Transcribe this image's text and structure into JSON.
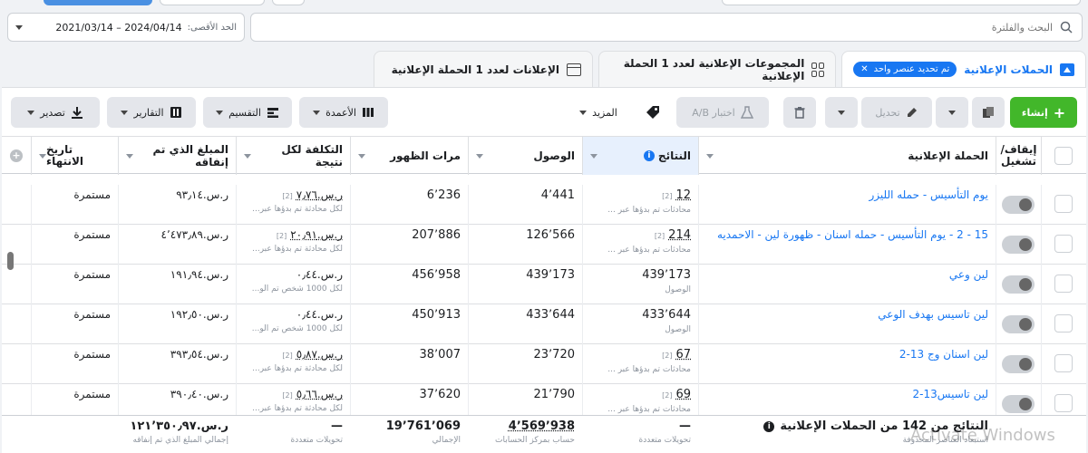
{
  "date_range": {
    "label": "الحد الأقصى:",
    "value": "2024/04/14 – 2021/03/14"
  },
  "search": {
    "placeholder": "البحث والفلترة"
  },
  "tabs": [
    {
      "label": "الحملات الإعلانية",
      "chip": "تم تحديد عنصر واحد"
    },
    {
      "label": "المجموعات الإعلانية لعدد 1 الحملة الإعلانية"
    },
    {
      "label": "الإعلانات لعدد 1 الحملة الإعلانية"
    }
  ],
  "toolbar": {
    "create": "إنشاء",
    "edit": "تحديل",
    "ab_test": "اختبار A/B",
    "more": "المزيد",
    "columns": "الأعمدة",
    "breakdown": "التقسيم",
    "reports": "التقارير",
    "export": "تصدير"
  },
  "columns": {
    "toggle": "إيقاف/ تشغيل",
    "campaign": "الحملة الإعلانية",
    "results": "النتائج",
    "reach": "الوصول",
    "impressions": "مرات الظهور",
    "cpr": "التكلفة لكل نتيجة",
    "spent": "المبلغ الذي تم إنفاقه",
    "end": "تاريخ الانتهاء"
  },
  "rows": [
    {
      "name": "يوم التأسيس - حمله الليزر",
      "result": "12",
      "result_sub": "محادثات تم بدؤها عبر ...",
      "reach": "4٬441",
      "impr": "6٬236",
      "cpr": "ر.س.٧٫٧٦",
      "cpr_sub": "لكل محادثة تم بدؤها عبر...",
      "spent": "ر.س.٩٣٫١٤",
      "end": "مستمرة"
    },
    {
      "name": "15 - 2 - يوم التأسيس - حمله اسنان - ظهورة لين - الاحمديه",
      "result": "214",
      "result_sub": "محادثات تم بدؤها عبر ...",
      "reach": "126٬566",
      "impr": "207٬886",
      "cpr": "ر.س.٢٠٫٩١",
      "cpr_sub": "لكل محادثة تم بدؤها عبر...",
      "spent": "ر.س.٤٬٤٧٣٫٨٩",
      "end": "مستمرة"
    },
    {
      "name": "لين وعي",
      "result": "439٬173",
      "result_sub": "الوصول",
      "reach": "439٬173",
      "impr": "456٬958",
      "cpr": "ر.س.٠٫٤٤",
      "cpr_sub": "لكل 1000 شخص تم الو...",
      "spent": "ر.س.١٩١٫٩٤",
      "end": "مستمرة"
    },
    {
      "name": "لين تاسيس بهدف الوعي",
      "result": "433٬644",
      "result_sub": "الوصول",
      "reach": "433٬644",
      "impr": "450٬913",
      "cpr": "ر.س.٠٫٤٤",
      "cpr_sub": "لكل 1000 شخص تم الو...",
      "spent": "ر.س.١٩٢٫٥٠",
      "end": "مستمرة"
    },
    {
      "name": "لين اسنان وج 13-2",
      "result": "67",
      "result_sub": "محادثات تم بدؤها عبر ...",
      "reach": "23٬720",
      "impr": "38٬007",
      "cpr": "ر.س.٥٫٨٧",
      "cpr_sub": "لكل محادثة تم بدؤها عبر...",
      "spent": "ر.س.٣٩٣٫٥٤",
      "end": "مستمرة"
    },
    {
      "name": "لين تاسيس13-2",
      "result": "69",
      "result_sub": "محادثات تم بدؤها عبر ...",
      "reach": "21٬790",
      "impr": "37٬620",
      "cpr": "ر.س.٥٫٦٦",
      "cpr_sub": "لكل محادثة تم بدؤها عبر...",
      "spent": "ر.س.٣٩٠٫٤٠",
      "end": "مستمرة"
    }
  ],
  "footer": {
    "title": "النتائج من 142 من الحملات الإعلانية",
    "title_sub": "استبعاد العناصر المحذوفة",
    "results": "—",
    "results_sub": "تحويلات متعددة",
    "reach": "4٬569٬938",
    "reach_sub": "حساب بمركز الحسابات",
    "impr": "19٬761٬069",
    "impr_sub": "الإجمالي",
    "cpr": "—",
    "cpr_sub": "تحويلات متعددة",
    "spent": "ر.س.١٢١٬٣٥٠٫٩٧",
    "spent_sub": "إجمالي المبلغ الذي تم إنفاقه"
  },
  "watermark": "Activate Windows",
  "badge": "[2]"
}
